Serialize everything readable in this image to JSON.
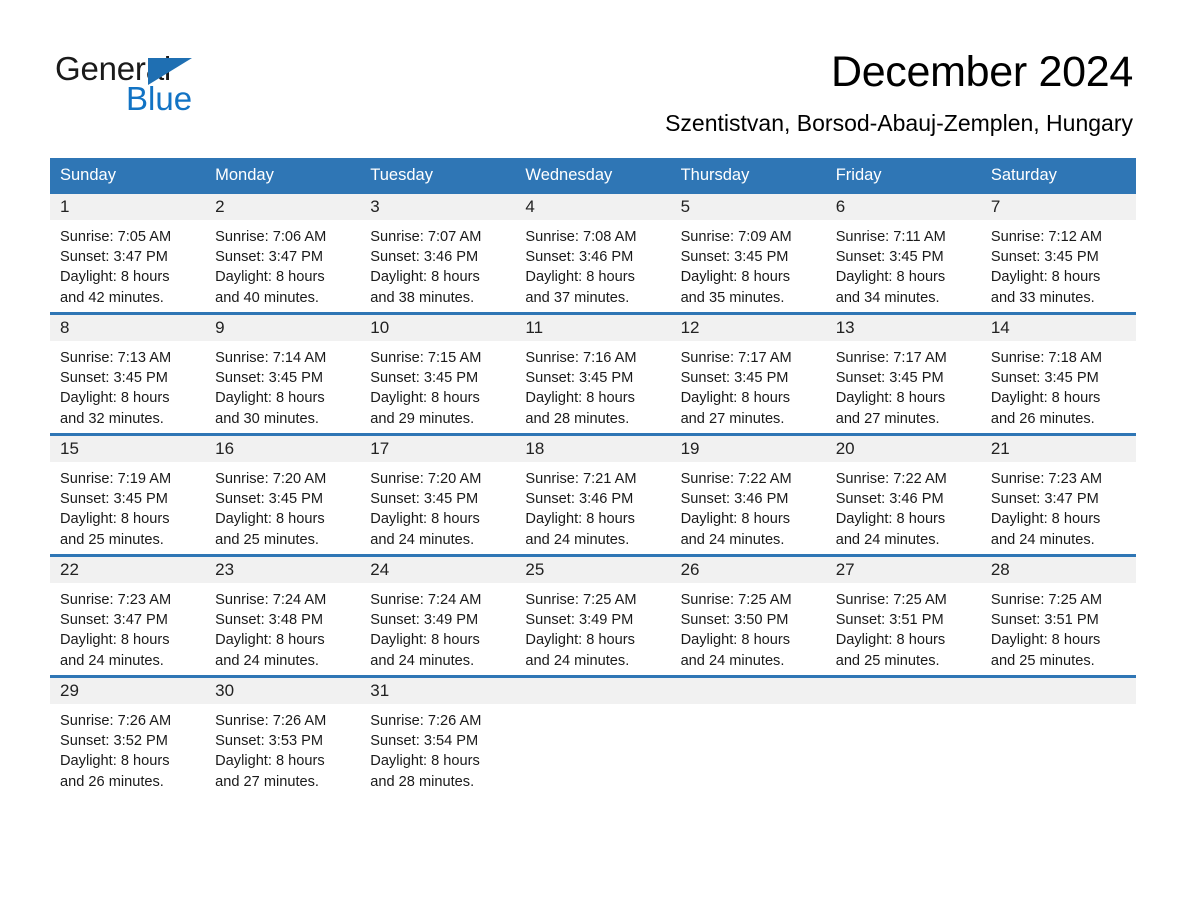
{
  "brand": {
    "name_part1": "General",
    "name_part2": "Blue",
    "triangle_color": "#1f6fb2",
    "blue_text_color": "#1273c4"
  },
  "header": {
    "title": "December 2024",
    "subtitle": "Szentistvan, Borsod-Abauj-Zemplen, Hungary"
  },
  "theme": {
    "header_blue": "#2f76b5",
    "daynum_band": "#f1f1f1",
    "text": "#1a1a1a"
  },
  "calendar": {
    "weekday_headers": [
      "Sunday",
      "Monday",
      "Tuesday",
      "Wednesday",
      "Thursday",
      "Friday",
      "Saturday"
    ],
    "weeks": [
      [
        {
          "day": "1",
          "sunrise": "Sunrise: 7:05 AM",
          "sunset": "Sunset: 3:47 PM",
          "daylight1": "Daylight: 8 hours",
          "daylight2": "and 42 minutes."
        },
        {
          "day": "2",
          "sunrise": "Sunrise: 7:06 AM",
          "sunset": "Sunset: 3:47 PM",
          "daylight1": "Daylight: 8 hours",
          "daylight2": "and 40 minutes."
        },
        {
          "day": "3",
          "sunrise": "Sunrise: 7:07 AM",
          "sunset": "Sunset: 3:46 PM",
          "daylight1": "Daylight: 8 hours",
          "daylight2": "and 38 minutes."
        },
        {
          "day": "4",
          "sunrise": "Sunrise: 7:08 AM",
          "sunset": "Sunset: 3:46 PM",
          "daylight1": "Daylight: 8 hours",
          "daylight2": "and 37 minutes."
        },
        {
          "day": "5",
          "sunrise": "Sunrise: 7:09 AM",
          "sunset": "Sunset: 3:45 PM",
          "daylight1": "Daylight: 8 hours",
          "daylight2": "and 35 minutes."
        },
        {
          "day": "6",
          "sunrise": "Sunrise: 7:11 AM",
          "sunset": "Sunset: 3:45 PM",
          "daylight1": "Daylight: 8 hours",
          "daylight2": "and 34 minutes."
        },
        {
          "day": "7",
          "sunrise": "Sunrise: 7:12 AM",
          "sunset": "Sunset: 3:45 PM",
          "daylight1": "Daylight: 8 hours",
          "daylight2": "and 33 minutes."
        }
      ],
      [
        {
          "day": "8",
          "sunrise": "Sunrise: 7:13 AM",
          "sunset": "Sunset: 3:45 PM",
          "daylight1": "Daylight: 8 hours",
          "daylight2": "and 32 minutes."
        },
        {
          "day": "9",
          "sunrise": "Sunrise: 7:14 AM",
          "sunset": "Sunset: 3:45 PM",
          "daylight1": "Daylight: 8 hours",
          "daylight2": "and 30 minutes."
        },
        {
          "day": "10",
          "sunrise": "Sunrise: 7:15 AM",
          "sunset": "Sunset: 3:45 PM",
          "daylight1": "Daylight: 8 hours",
          "daylight2": "and 29 minutes."
        },
        {
          "day": "11",
          "sunrise": "Sunrise: 7:16 AM",
          "sunset": "Sunset: 3:45 PM",
          "daylight1": "Daylight: 8 hours",
          "daylight2": "and 28 minutes."
        },
        {
          "day": "12",
          "sunrise": "Sunrise: 7:17 AM",
          "sunset": "Sunset: 3:45 PM",
          "daylight1": "Daylight: 8 hours",
          "daylight2": "and 27 minutes."
        },
        {
          "day": "13",
          "sunrise": "Sunrise: 7:17 AM",
          "sunset": "Sunset: 3:45 PM",
          "daylight1": "Daylight: 8 hours",
          "daylight2": "and 27 minutes."
        },
        {
          "day": "14",
          "sunrise": "Sunrise: 7:18 AM",
          "sunset": "Sunset: 3:45 PM",
          "daylight1": "Daylight: 8 hours",
          "daylight2": "and 26 minutes."
        }
      ],
      [
        {
          "day": "15",
          "sunrise": "Sunrise: 7:19 AM",
          "sunset": "Sunset: 3:45 PM",
          "daylight1": "Daylight: 8 hours",
          "daylight2": "and 25 minutes."
        },
        {
          "day": "16",
          "sunrise": "Sunrise: 7:20 AM",
          "sunset": "Sunset: 3:45 PM",
          "daylight1": "Daylight: 8 hours",
          "daylight2": "and 25 minutes."
        },
        {
          "day": "17",
          "sunrise": "Sunrise: 7:20 AM",
          "sunset": "Sunset: 3:45 PM",
          "daylight1": "Daylight: 8 hours",
          "daylight2": "and 24 minutes."
        },
        {
          "day": "18",
          "sunrise": "Sunrise: 7:21 AM",
          "sunset": "Sunset: 3:46 PM",
          "daylight1": "Daylight: 8 hours",
          "daylight2": "and 24 minutes."
        },
        {
          "day": "19",
          "sunrise": "Sunrise: 7:22 AM",
          "sunset": "Sunset: 3:46 PM",
          "daylight1": "Daylight: 8 hours",
          "daylight2": "and 24 minutes."
        },
        {
          "day": "20",
          "sunrise": "Sunrise: 7:22 AM",
          "sunset": "Sunset: 3:46 PM",
          "daylight1": "Daylight: 8 hours",
          "daylight2": "and 24 minutes."
        },
        {
          "day": "21",
          "sunrise": "Sunrise: 7:23 AM",
          "sunset": "Sunset: 3:47 PM",
          "daylight1": "Daylight: 8 hours",
          "daylight2": "and 24 minutes."
        }
      ],
      [
        {
          "day": "22",
          "sunrise": "Sunrise: 7:23 AM",
          "sunset": "Sunset: 3:47 PM",
          "daylight1": "Daylight: 8 hours",
          "daylight2": "and 24 minutes."
        },
        {
          "day": "23",
          "sunrise": "Sunrise: 7:24 AM",
          "sunset": "Sunset: 3:48 PM",
          "daylight1": "Daylight: 8 hours",
          "daylight2": "and 24 minutes."
        },
        {
          "day": "24",
          "sunrise": "Sunrise: 7:24 AM",
          "sunset": "Sunset: 3:49 PM",
          "daylight1": "Daylight: 8 hours",
          "daylight2": "and 24 minutes."
        },
        {
          "day": "25",
          "sunrise": "Sunrise: 7:25 AM",
          "sunset": "Sunset: 3:49 PM",
          "daylight1": "Daylight: 8 hours",
          "daylight2": "and 24 minutes."
        },
        {
          "day": "26",
          "sunrise": "Sunrise: 7:25 AM",
          "sunset": "Sunset: 3:50 PM",
          "daylight1": "Daylight: 8 hours",
          "daylight2": "and 24 minutes."
        },
        {
          "day": "27",
          "sunrise": "Sunrise: 7:25 AM",
          "sunset": "Sunset: 3:51 PM",
          "daylight1": "Daylight: 8 hours",
          "daylight2": "and 25 minutes."
        },
        {
          "day": "28",
          "sunrise": "Sunrise: 7:25 AM",
          "sunset": "Sunset: 3:51 PM",
          "daylight1": "Daylight: 8 hours",
          "daylight2": "and 25 minutes."
        }
      ],
      [
        {
          "day": "29",
          "sunrise": "Sunrise: 7:26 AM",
          "sunset": "Sunset: 3:52 PM",
          "daylight1": "Daylight: 8 hours",
          "daylight2": "and 26 minutes."
        },
        {
          "day": "30",
          "sunrise": "Sunrise: 7:26 AM",
          "sunset": "Sunset: 3:53 PM",
          "daylight1": "Daylight: 8 hours",
          "daylight2": "and 27 minutes."
        },
        {
          "day": "31",
          "sunrise": "Sunrise: 7:26 AM",
          "sunset": "Sunset: 3:54 PM",
          "daylight1": "Daylight: 8 hours",
          "daylight2": "and 28 minutes."
        },
        {
          "day": "",
          "sunrise": "",
          "sunset": "",
          "daylight1": "",
          "daylight2": ""
        },
        {
          "day": "",
          "sunrise": "",
          "sunset": "",
          "daylight1": "",
          "daylight2": ""
        },
        {
          "day": "",
          "sunrise": "",
          "sunset": "",
          "daylight1": "",
          "daylight2": ""
        },
        {
          "day": "",
          "sunrise": "",
          "sunset": "",
          "daylight1": "",
          "daylight2": ""
        }
      ]
    ]
  }
}
